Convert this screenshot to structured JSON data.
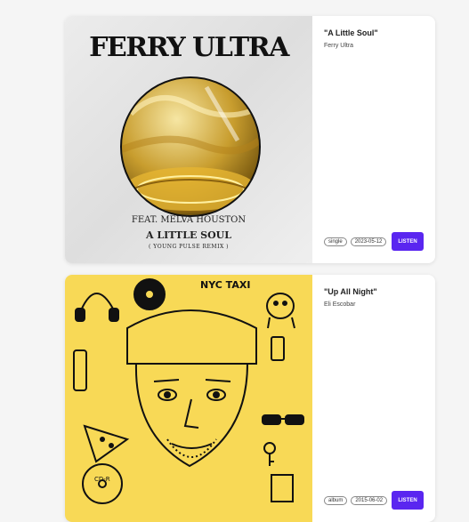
{
  "colors": {
    "accent": "#5a26f0",
    "cover2_bg": "#f8d956"
  },
  "cards": [
    {
      "title": "\"A Little Soul\"",
      "artist": "Ferry Ultra",
      "tags": [
        "single",
        "2023-05-12"
      ],
      "button": "LISTEN",
      "cover": {
        "band": "FERRY ULTRA",
        "feat": "FEAT. MELVA HOUSTON",
        "song": "A LITTLE SOUL",
        "remix": "( YOUNG PULSE REMIX )"
      }
    },
    {
      "title": "\"Up All Night\"",
      "artist": "Eli Escobar",
      "tags": [
        "album",
        "2015-06-02"
      ],
      "button": "LISTEN",
      "cover": {
        "sign": "NYC TAXI",
        "cd_label": "CD-R"
      }
    }
  ]
}
